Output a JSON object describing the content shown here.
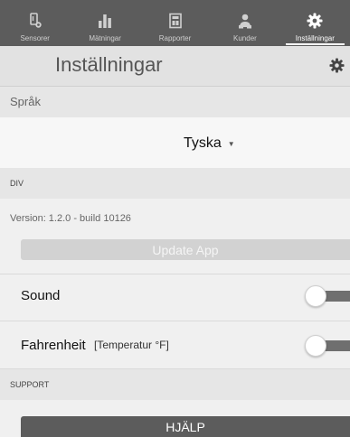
{
  "colors": {
    "tabbar_bg": "#5c5c5c",
    "header_bg": "#e2e2e2",
    "section_bg": "#e6e6e6",
    "update_button": "#d2d2d2",
    "help_button": "#5c5c5c",
    "toggle_track": "#6f6f6f"
  },
  "tabbar": {
    "tabs": [
      {
        "label": "Sensorer",
        "icon": "sensor-icon",
        "active": false
      },
      {
        "label": "Mätningar",
        "icon": "bar-chart-icon",
        "active": false
      },
      {
        "label": "Rapporter",
        "icon": "report-icon",
        "active": false
      },
      {
        "label": "Kunder",
        "icon": "customers-icon",
        "active": false
      },
      {
        "label": "Inställningar",
        "icon": "gear-icon",
        "active": true
      }
    ]
  },
  "header": {
    "title": "Inställningar",
    "icon": "gear-icon"
  },
  "language": {
    "section_label": "Språk",
    "selected": "Tyska",
    "caret": "▼"
  },
  "div_section": {
    "label": "DIV",
    "version": "Version: 1.2.0 - build 10126",
    "update_label": "Update App"
  },
  "settings": {
    "sound": {
      "label": "Sound",
      "enabled": false
    },
    "fahrenheit": {
      "label": "Fahrenheit",
      "sublabel": "[Temperatur °F]",
      "enabled": false
    }
  },
  "support": {
    "label": "SUPPORT",
    "help_label": "HJÄLP"
  }
}
